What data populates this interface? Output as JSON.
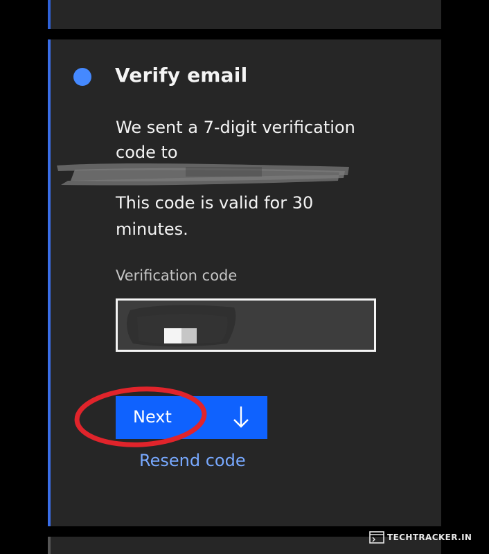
{
  "step": {
    "title": "Verify email",
    "description": "We sent a 7-digit verification code to",
    "validity": "This code is valid for 30 minutes.",
    "status_color": "#4589ff"
  },
  "form": {
    "code_label": "Verification code",
    "code_value": ""
  },
  "actions": {
    "next_label": "Next",
    "next_icon": "arrow-down-icon",
    "resend_label": "Resend code"
  },
  "annotation": {
    "highlight_color": "#e0242b"
  },
  "watermark": {
    "text": "TECHTRACKER.IN"
  },
  "colors": {
    "background": "#000000",
    "card": "#262626",
    "accent": "#0f62fe",
    "link": "#78a9ff"
  }
}
